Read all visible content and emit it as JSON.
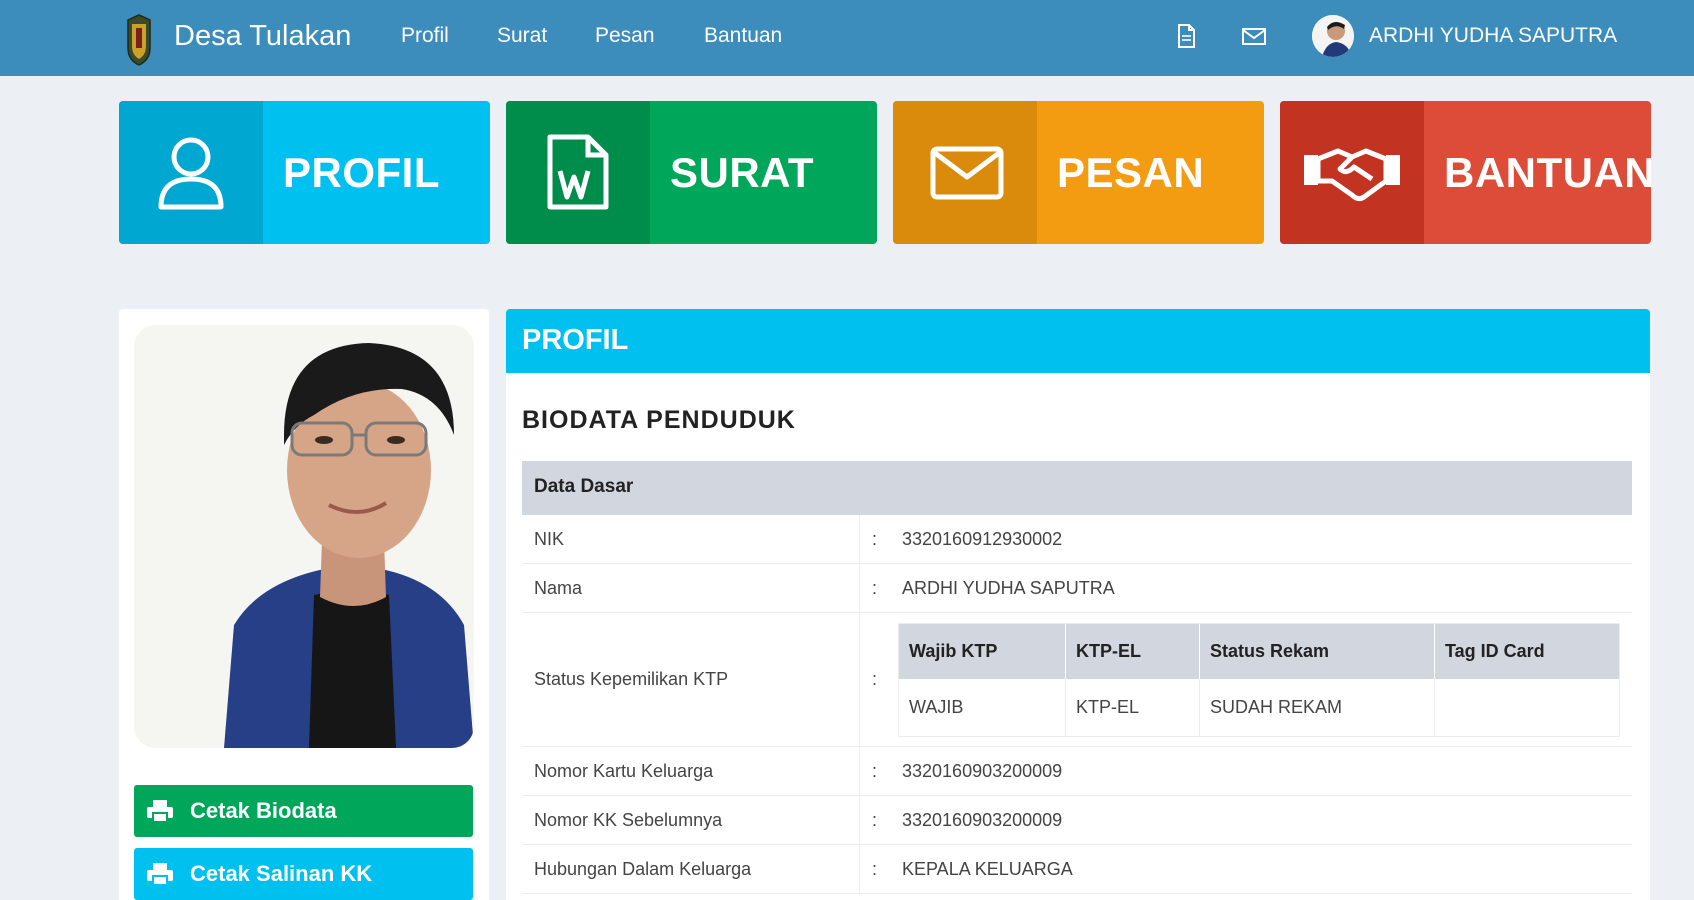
{
  "header": {
    "brand": "Desa Tulakan",
    "nav": [
      "Profil",
      "Surat",
      "Pesan",
      "Bantuan"
    ],
    "icons": [
      "document-icon",
      "envelope-icon"
    ],
    "user_name": "ARDHI YUDHA SAPUTRA",
    "bg_color": "#3c8dbc"
  },
  "tiles": [
    {
      "label": "PROFIL",
      "icon": "user-icon",
      "color": "#00c0ef",
      "dark": "#00a7d0"
    },
    {
      "label": "SURAT",
      "icon": "word-document-icon",
      "color": "#00a65a",
      "dark": "#008d4c"
    },
    {
      "label": "PESAN",
      "icon": "envelope-icon",
      "color": "#f39c12",
      "dark": "#db8b0b"
    },
    {
      "label": "BANTUAN",
      "icon": "handshake-icon",
      "color": "#dd4b39",
      "dark": "#c23321"
    }
  ],
  "actions": {
    "print_biodata": "Cetak Biodata",
    "print_kk": "Cetak Salinan KK"
  },
  "panel": {
    "title": "PROFIL",
    "section_title": "BIODATA PENDUDUK",
    "table_header": "Data Dasar",
    "separator": ":",
    "rows": [
      {
        "label": "NIK",
        "value": "3320160912930002"
      },
      {
        "label": "Nama",
        "value": "ARDHI YUDHA SAPUTRA"
      },
      {
        "label": "Status Kepemilikan KTP",
        "value": ""
      },
      {
        "label": "Nomor Kartu Keluarga",
        "value": "3320160903200009"
      },
      {
        "label": "Nomor KK Sebelumnya",
        "value": "3320160903200009"
      },
      {
        "label": "Hubungan Dalam Keluarga",
        "value": "KEPALA KELUARGA"
      }
    ],
    "ktp": {
      "headers": [
        "Wajib KTP",
        "KTP-EL",
        "Status Rekam",
        "Tag ID Card"
      ],
      "values": [
        "WAJIB",
        "KTP-EL",
        "SUDAH REKAM",
        ""
      ]
    }
  }
}
